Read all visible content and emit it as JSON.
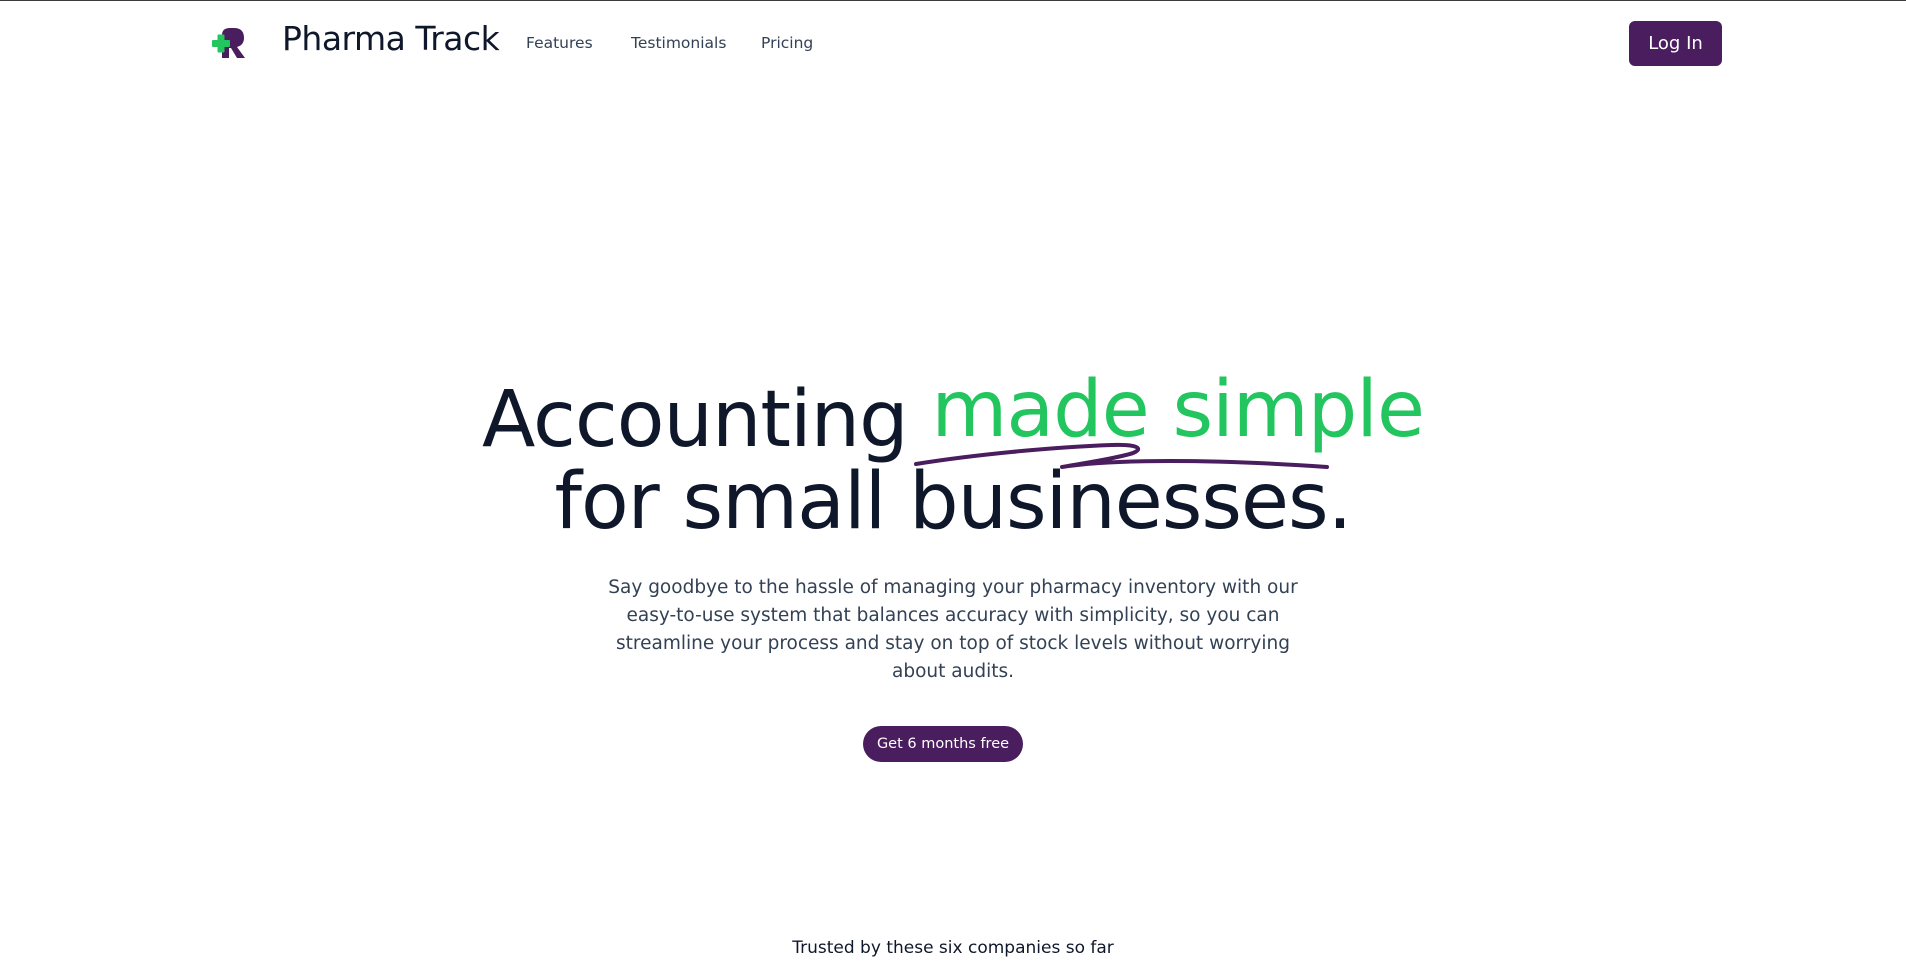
{
  "header": {
    "brand_name": "Pharma Track",
    "logo_icon": "pharmacy-cross-logo-icon",
    "nav": [
      {
        "label": "Features"
      },
      {
        "label": "Testimonials"
      },
      {
        "label": "Pricing"
      }
    ],
    "login_label": "Log In"
  },
  "hero": {
    "title_part1": "Accounting",
    "title_accent": "made simple",
    "title_line2": "for small businesses.",
    "subtitle": "Say goodbye to the hassle of managing your pharmacy inventory with our easy-to-use system that balances accuracy with simplicity, so you can streamline your process and stay on top of stock levels without worrying about audits.",
    "cta_label": "Get 6 months free"
  },
  "trusted": {
    "text": "Trusted by these six companies so far"
  },
  "colors": {
    "brand_purple": "#4a1d5e",
    "accent_green": "#22c55e",
    "text_dark": "#0f172a"
  }
}
